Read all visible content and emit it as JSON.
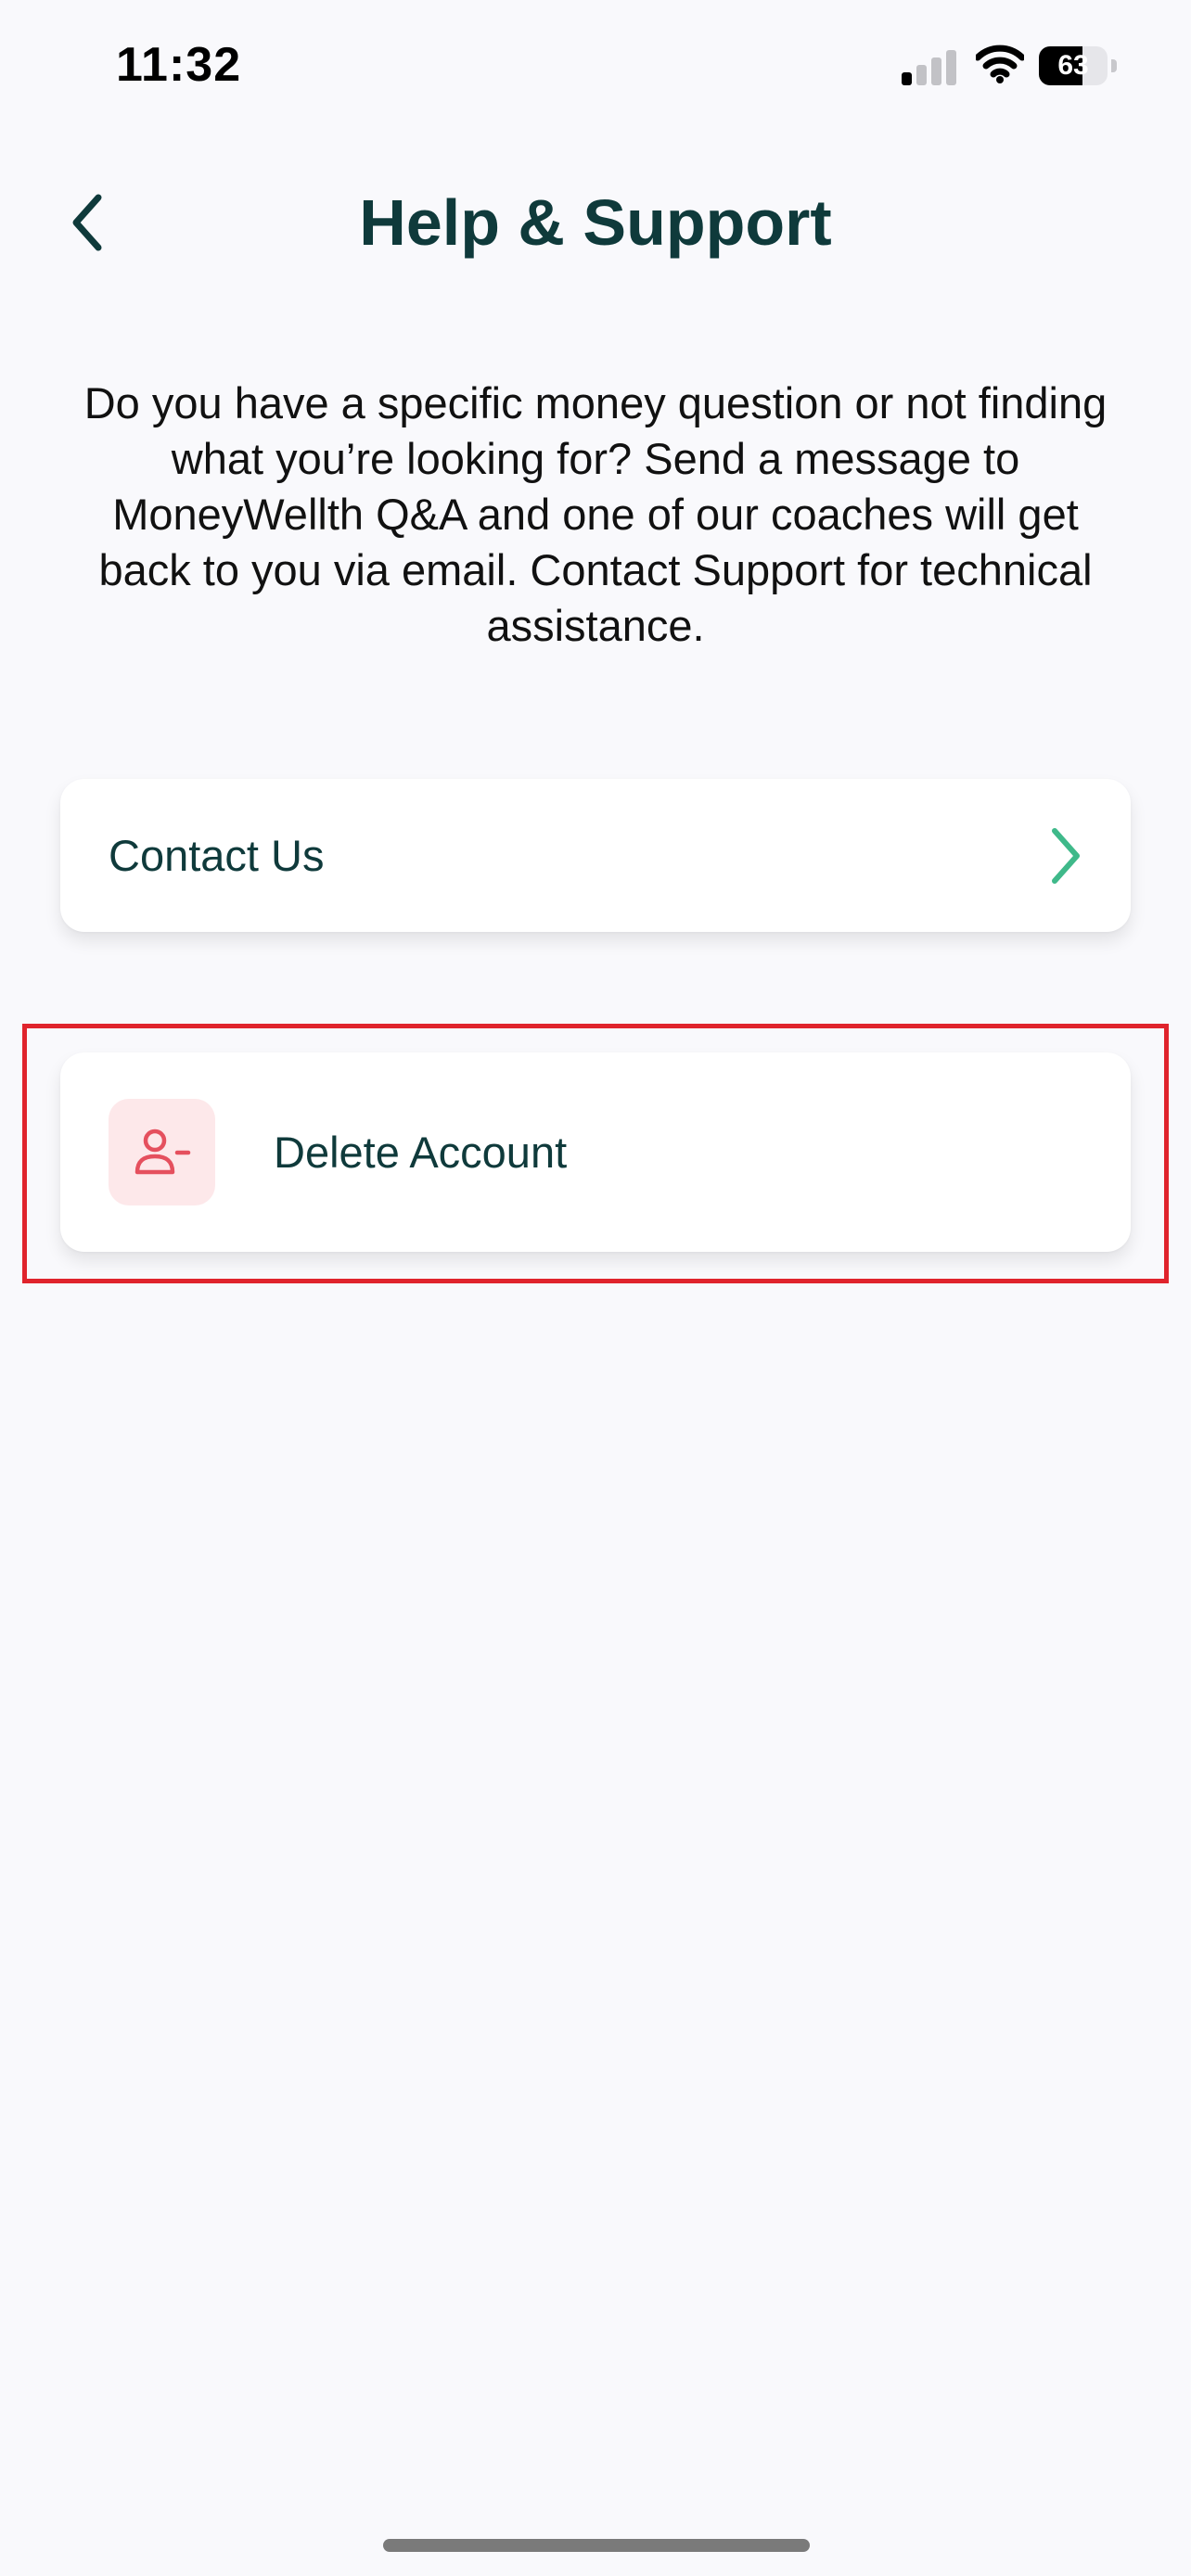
{
  "status_bar": {
    "time": "11:32",
    "battery_level": "63",
    "battery_fraction": 0.63,
    "signal_bars_active": 1,
    "signal_bars_total": 4
  },
  "header": {
    "title": "Help & Support",
    "back_icon": "chevron-left-icon"
  },
  "description": "Do you have a specific money question or not finding what you’re looking for? Send a message to MoneyWellth Q&A and one of our coaches will get back to you via email. Contact Support for technical assistance.",
  "menu": {
    "contact": {
      "label": "Contact Us",
      "icon": "chevron-right-icon"
    },
    "delete_account": {
      "label": "Delete Account",
      "icon": "user-minus-icon"
    }
  },
  "colors": {
    "title": "#0f3a3b",
    "accent_green": "#3fb98a",
    "danger": "#e5505e",
    "danger_bg": "#fde8ea",
    "highlight": "#e0242c",
    "background": "#f9f9fc"
  }
}
